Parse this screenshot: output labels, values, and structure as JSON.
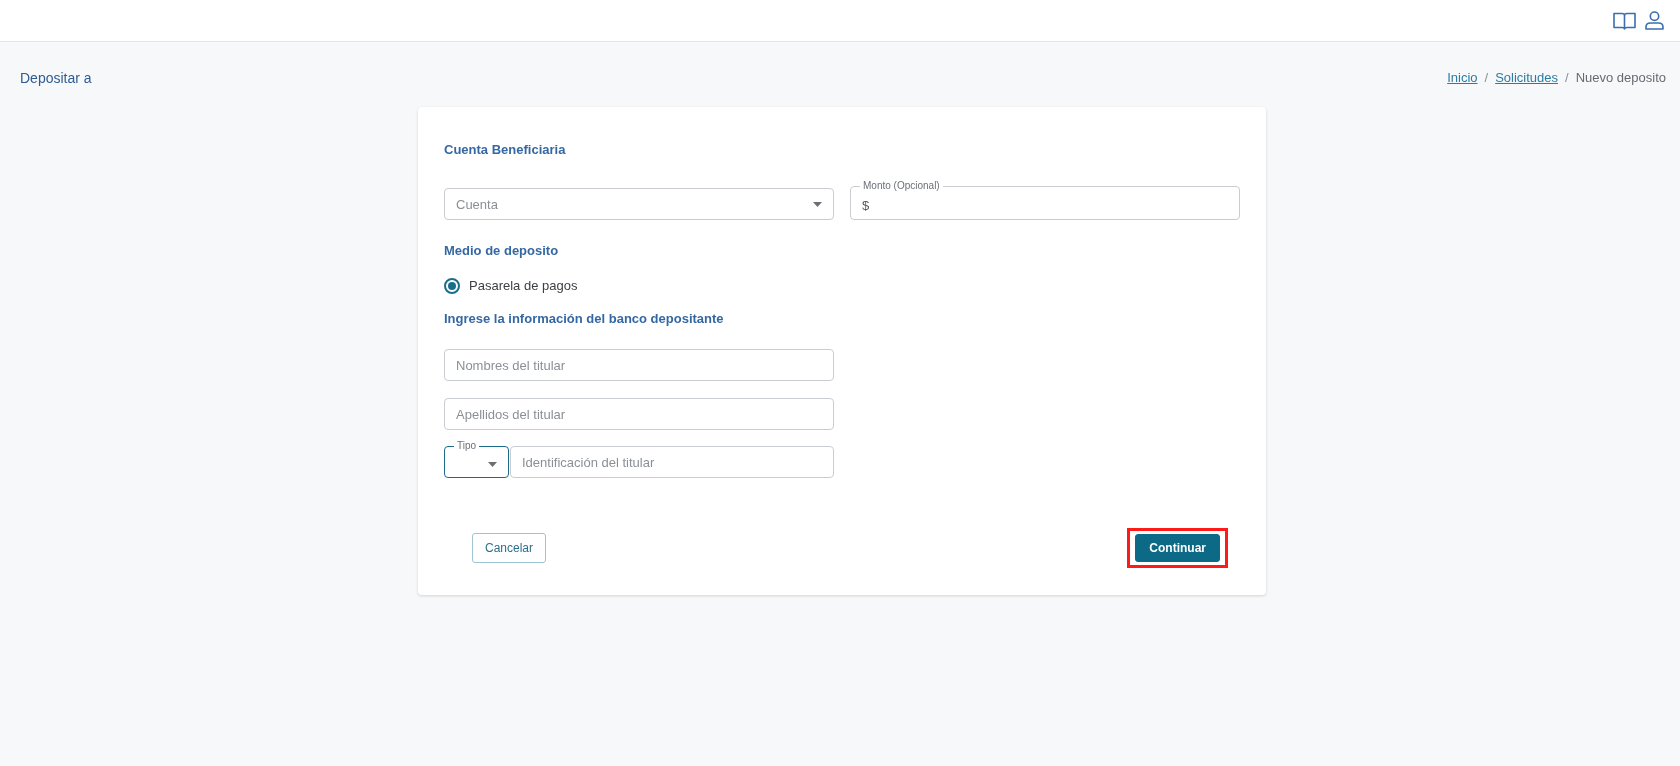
{
  "page_title": "Depositar a",
  "breadcrumb": [
    {
      "kind": "link",
      "label": "Inicio"
    },
    {
      "kind": "separator",
      "label": "/"
    },
    {
      "kind": "link",
      "label": "Solicitudes"
    },
    {
      "kind": "separator",
      "label": "/"
    },
    {
      "kind": "current",
      "label": "Nuevo deposito"
    }
  ],
  "beneficiary": {
    "heading": "Cuenta Beneficiaria",
    "account_select": {
      "placeholder": "Cuenta"
    },
    "amount_field": {
      "label": "Monto (Opcional)",
      "prefix": "$"
    }
  },
  "deposit_method": {
    "heading": "Medio de deposito",
    "options": [
      {
        "label": "Pasarela de pagos",
        "selected": true
      }
    ]
  },
  "depositor_bank": {
    "heading": "Ingrese la información del banco depositante",
    "holder_names": {
      "placeholder": "Nombres del titular"
    },
    "holder_surnames": {
      "placeholder": "Apellidos del titular"
    },
    "id_type_select": {
      "label": "Tipo",
      "focused": true
    },
    "holder_id": {
      "placeholder": "Identificación del titular"
    }
  },
  "actions": [
    {
      "kind": "secondary",
      "label": "Cancelar",
      "highlighted": false
    },
    {
      "kind": "primary",
      "label": "Continuar",
      "highlighted": true
    }
  ]
}
